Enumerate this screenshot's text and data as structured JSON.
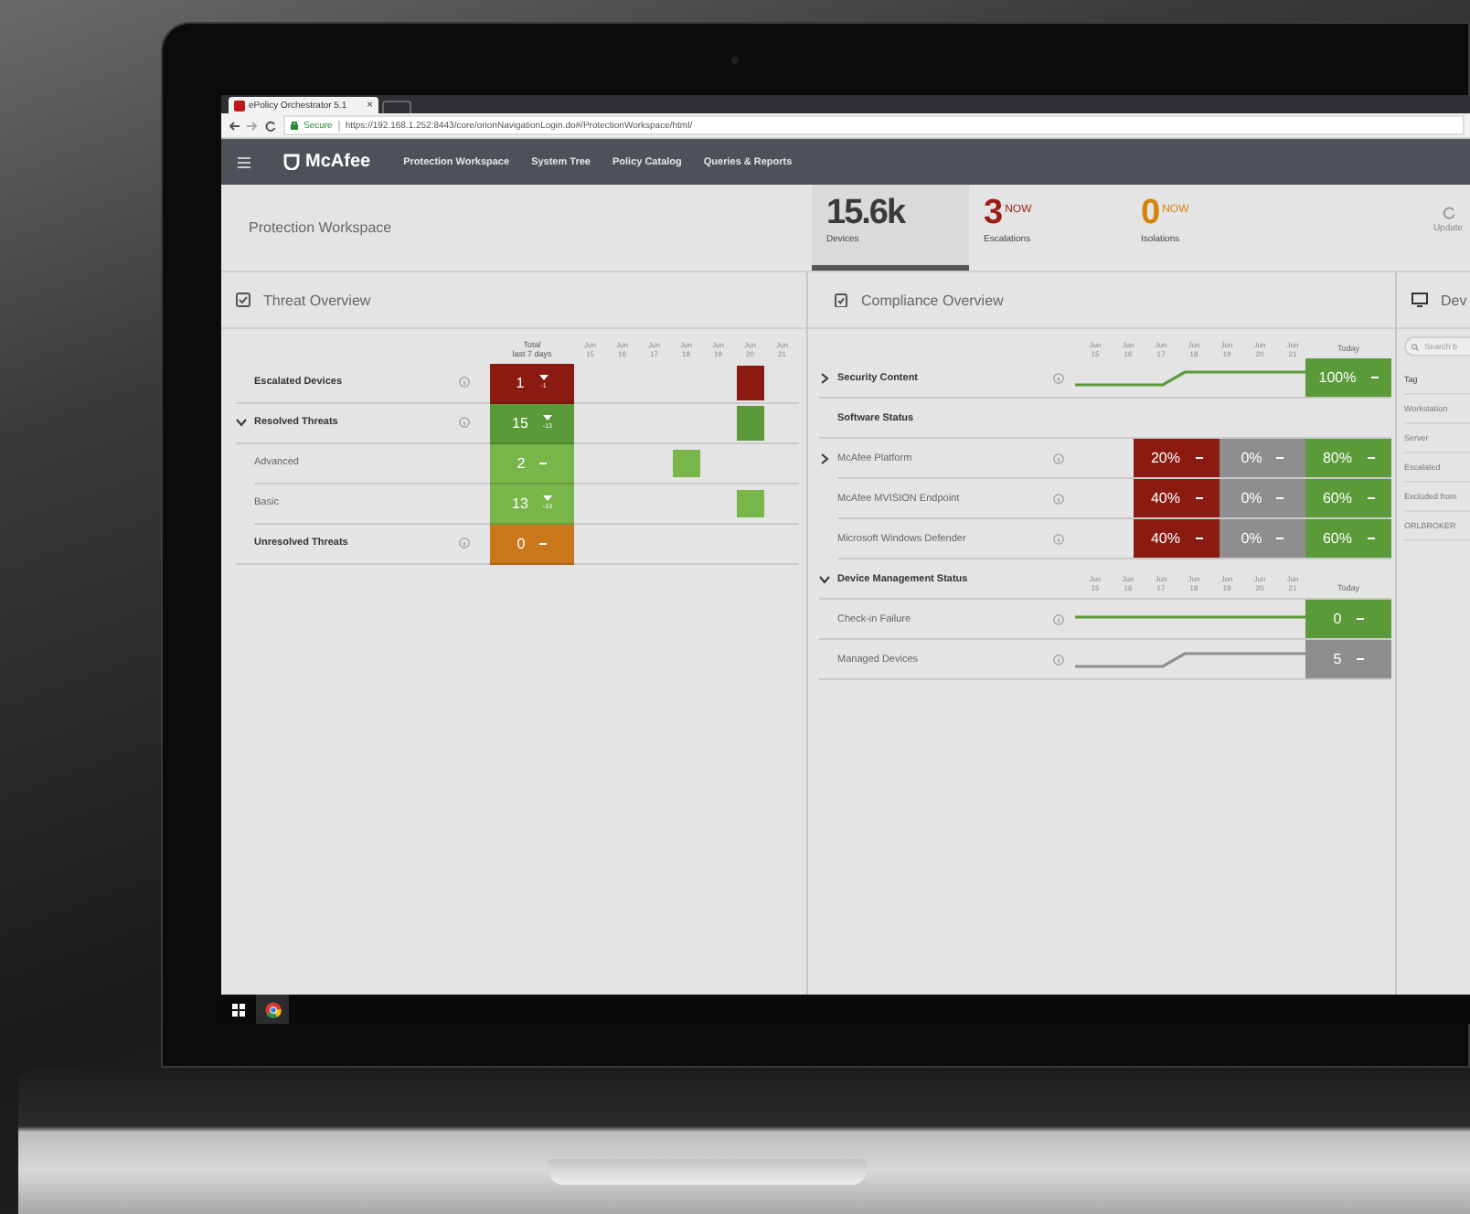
{
  "browser": {
    "tab_title": "ePolicy Orchestrator 5.1",
    "tab_close": "×",
    "secure_label": "Secure",
    "url": "https://192.168.1.252:8443/core/orionNavigationLogin.do#/ProtectionWorkspace/html/"
  },
  "nav": {
    "logo": "McAfee",
    "items": [
      "Protection Workspace",
      "System Tree",
      "Policy Catalog",
      "Queries & Reports"
    ]
  },
  "header": {
    "title": "Protection Workspace",
    "update_label": "Update",
    "stats": [
      {
        "value": "15.6k",
        "label": "Devices",
        "selected": true,
        "color": "#3a3a3a"
      },
      {
        "value": "3",
        "badge": "NOW",
        "label": "Escalations",
        "selected": false,
        "color": "#9b1c14"
      },
      {
        "value": "0",
        "badge": "NOW",
        "label": "Isolations",
        "selected": false,
        "color": "#d4820a"
      }
    ]
  },
  "threat": {
    "title": "Threat Overview",
    "total_header": "Total",
    "total_subheader": "last 7 days",
    "days": [
      {
        "month": "Jun",
        "day": "15"
      },
      {
        "month": "Jun",
        "day": "16"
      },
      {
        "month": "Jun",
        "day": "17"
      },
      {
        "month": "Jun",
        "day": "18"
      },
      {
        "month": "Jun",
        "day": "19"
      },
      {
        "month": "Jun",
        "day": "20"
      },
      {
        "month": "Jun",
        "day": "21"
      }
    ],
    "rows": [
      {
        "kind": "group",
        "label": "Escalated Devices",
        "value": "1",
        "color": "#8b1a10",
        "falling": true,
        "delta": "-1",
        "marks": [
          false,
          false,
          false,
          false,
          false,
          true,
          false
        ]
      },
      {
        "kind": "parent",
        "label": "Resolved Threats",
        "expanded": true,
        "value": "15",
        "color": "#5a9a38",
        "falling": true,
        "delta": "-13",
        "marks": [
          false,
          false,
          false,
          false,
          false,
          true,
          false
        ]
      },
      {
        "kind": "sub",
        "label": "Advanced",
        "value": "2",
        "color": "#79b64a",
        "falling": false,
        "marks": [
          false,
          false,
          false,
          true,
          false,
          false,
          false
        ]
      },
      {
        "kind": "sub",
        "label": "Basic",
        "value": "13",
        "color": "#79b64a",
        "falling": true,
        "delta": "-13",
        "marks": [
          false,
          false,
          false,
          false,
          false,
          true,
          false
        ]
      },
      {
        "kind": "group",
        "label": "Unresolved Threats",
        "value": "0",
        "color": "#c9781c",
        "falling": false,
        "marks": [
          false,
          false,
          false,
          false,
          false,
          false,
          false
        ]
      }
    ]
  },
  "compliance": {
    "title": "Compliance Overview",
    "today_header": "Today",
    "days": [
      {
        "month": "Jun",
        "day": "15"
      },
      {
        "month": "Jun",
        "day": "16"
      },
      {
        "month": "Jun",
        "day": "17"
      },
      {
        "month": "Jun",
        "day": "18"
      },
      {
        "month": "Jun",
        "day": "19"
      },
      {
        "month": "Jun",
        "day": "20"
      },
      {
        "month": "Jun",
        "day": "21"
      }
    ],
    "rows": [
      {
        "kind": "summary",
        "label": "Security Content",
        "expanded": false,
        "rising": true,
        "color": "#5a9a38",
        "today": {
          "value": "100%",
          "color": "#5a9a38"
        }
      },
      {
        "kind": "heading",
        "label": "Software Status"
      },
      {
        "kind": "product",
        "label": "McAfee Platform",
        "expanded": false,
        "cells": [
          {
            "value": "20%",
            "color": "#8b1a10"
          },
          {
            "value": "0%",
            "color": "#8e8e90"
          },
          {
            "value": "80%",
            "color": "#5a9a38"
          }
        ]
      },
      {
        "kind": "product",
        "label": "McAfee MVISION Endpoint",
        "cells": [
          {
            "value": "40%",
            "color": "#8b1a10"
          },
          {
            "value": "0%",
            "color": "#8e8e90"
          },
          {
            "value": "60%",
            "color": "#5a9a38"
          }
        ]
      },
      {
        "kind": "product",
        "label": "Microsoft Windows Defender",
        "cells": [
          {
            "value": "40%",
            "color": "#8b1a10"
          },
          {
            "value": "0%",
            "color": "#8e8e90"
          },
          {
            "value": "60%",
            "color": "#5a9a38"
          }
        ]
      },
      {
        "kind": "heading-days",
        "label": "Device Management Status",
        "expanded": true,
        "today_header": "Today",
        "days": [
          {
            "month": "Jun",
            "day": "15"
          },
          {
            "month": "Jun",
            "day": "16"
          },
          {
            "month": "Jun",
            "day": "17"
          },
          {
            "month": "Jun",
            "day": "18"
          },
          {
            "month": "Jun",
            "day": "19"
          },
          {
            "month": "Jun",
            "day": "20"
          },
          {
            "month": "Jun",
            "day": "21"
          }
        ]
      },
      {
        "kind": "metric",
        "label": "Check-in Failure",
        "rising": false,
        "color": "#5a9a38",
        "today": {
          "value": "0",
          "color": "#5a9a38"
        }
      },
      {
        "kind": "metric",
        "label": "Managed Devices",
        "rising": true,
        "color": "#8e8e90",
        "today": {
          "value": "5",
          "color": "#8e8e90"
        }
      }
    ]
  },
  "devices": {
    "title": "Dev",
    "search_placeholder": "Search b",
    "rows": [
      "Tag",
      "Workstation",
      "Server",
      "Escalated",
      "Excluded from",
      "ORLBROKER"
    ]
  }
}
